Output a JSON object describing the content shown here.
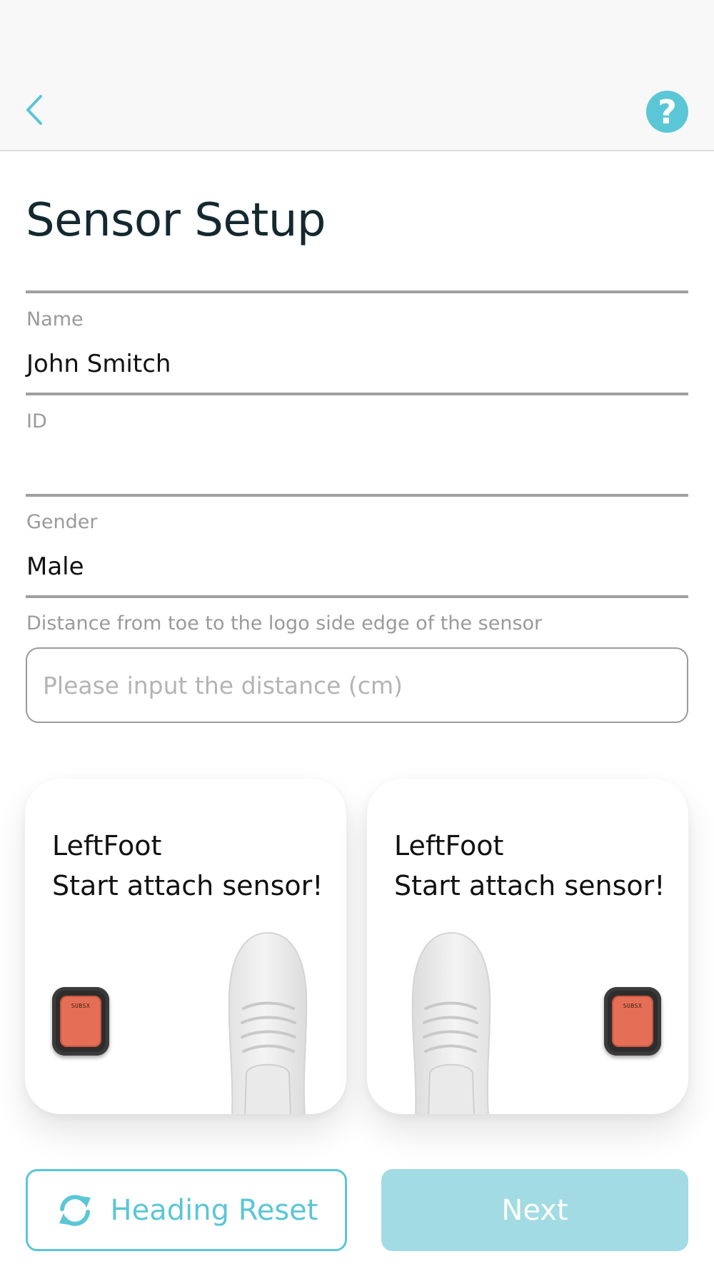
{
  "header": {
    "back_icon": "chevron-left-icon",
    "help_icon": "question-mark-icon",
    "help_glyph": "?",
    "accent_color": "#5bc6d6"
  },
  "page": {
    "title": "Sensor Setup"
  },
  "form": {
    "name_label": "Name",
    "name_value": "John Smitch",
    "id_label": "ID",
    "id_value": "",
    "gender_label": "Gender",
    "gender_value": "Male",
    "distance_label": "Distance from toe to the logo side edge of the sensor",
    "distance_placeholder": "Please input the distance (cm)",
    "distance_value": ""
  },
  "cards": [
    {
      "line1": "LeftFoot",
      "line2": "Start attach sensor!",
      "sensor_logo": "SUBSX"
    },
    {
      "line1": "LeftFoot",
      "line2": "Start attach sensor!",
      "sensor_logo": "SUBSX"
    }
  ],
  "buttons": {
    "heading_reset_label": "Heading Reset",
    "heading_reset_icon": "refresh-icon",
    "next_label": "Next"
  }
}
